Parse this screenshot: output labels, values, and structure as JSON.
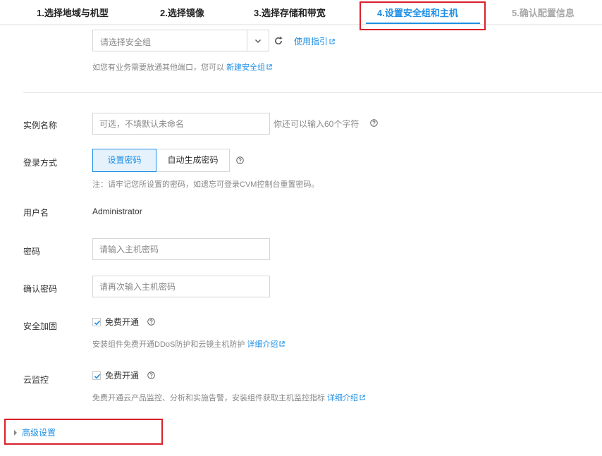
{
  "steps": [
    {
      "label": "1.选择地域与机型"
    },
    {
      "label": "2.选择镜像"
    },
    {
      "label": "3.选择存储和带宽"
    },
    {
      "label": "4.设置安全组和主机"
    },
    {
      "label": "5.确认配置信息"
    }
  ],
  "active_step_index": 3,
  "security_group": {
    "select_placeholder": "请选择安全组",
    "guide_link": "使用指引",
    "hint_prefix": "如您有业务需要放通其他端口，您可以",
    "hint_link": "新建安全组"
  },
  "instance_name": {
    "label": "实例名称",
    "placeholder": "可选，不填默认未命名",
    "hint": "你还可以输入60个字符"
  },
  "login": {
    "label": "登录方式",
    "options": [
      "设置密码",
      "自动生成密码"
    ],
    "selected": "设置密码",
    "hint": "注：请牢记您所设置的密码，如遗忘可登录CVM控制台重置密码。"
  },
  "username": {
    "label": "用户名",
    "value": "Administrator"
  },
  "password": {
    "label": "密码",
    "placeholder": "请输入主机密码"
  },
  "confirm_password": {
    "label": "确认密码",
    "placeholder": "请再次输入主机密码"
  },
  "security_hardening": {
    "label": "安全加固",
    "checkbox_label": "免费开通",
    "checked": true,
    "hint": "安装组件免费开通DDoS防护和云镜主机防护",
    "hint_link": "详细介绍"
  },
  "cloud_monitor": {
    "label": "云监控",
    "checkbox_label": "免费开通",
    "checked": true,
    "hint": "免费开通云产品监控、分析和实施告警，安装组件获取主机监控指标",
    "hint_link": "详细介绍"
  },
  "advanced": {
    "label": "高级设置"
  },
  "colors": {
    "accent": "#1e8fe6",
    "highlight_box": "#d9202a",
    "muted_text": "#888888"
  }
}
